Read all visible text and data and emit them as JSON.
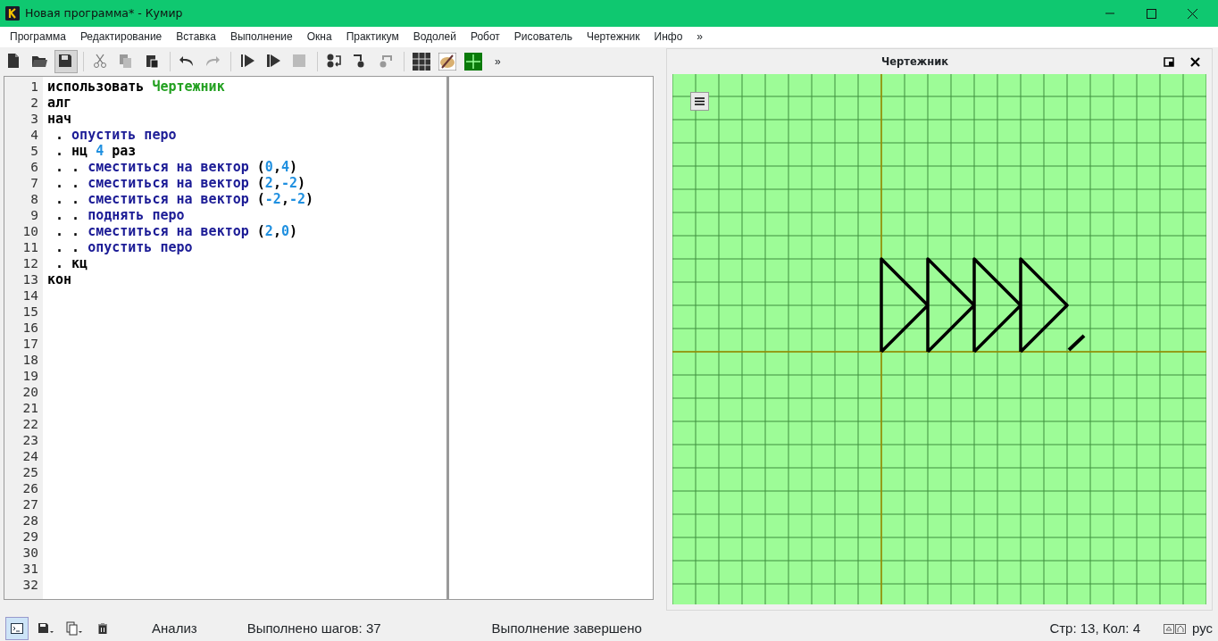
{
  "window": {
    "title": "Новая программа* - Кумир"
  },
  "menu": [
    {
      "label": "Программа"
    },
    {
      "label": "Редактирование"
    },
    {
      "label": "Вставка"
    },
    {
      "label": "Выполнение"
    },
    {
      "label": "Окна"
    },
    {
      "label": "Практикум"
    },
    {
      "label": "Водолей"
    },
    {
      "label": "Робот"
    },
    {
      "label": "Рисователь"
    },
    {
      "label": "Чертежник"
    },
    {
      "label": "Инфо"
    },
    {
      "label": "»"
    }
  ],
  "toolbar": {
    "overflow": "»"
  },
  "editor": {
    "lines": [
      {
        "number": "1",
        "tokens": [
          {
            "text": "использовать ",
            "kind": "keyword"
          },
          {
            "text": "Чертежник",
            "kind": "module"
          }
        ]
      },
      {
        "number": "2",
        "tokens": [
          {
            "text": "алг",
            "kind": "keyword"
          }
        ]
      },
      {
        "number": "3",
        "tokens": [
          {
            "text": "нач",
            "kind": "keyword"
          }
        ]
      },
      {
        "number": "4",
        "tokens": [
          {
            "text": " . ",
            "kind": "plain"
          },
          {
            "text": "опустить перо",
            "kind": "command"
          }
        ]
      },
      {
        "number": "5",
        "tokens": [
          {
            "text": " . ",
            "kind": "plain"
          },
          {
            "text": "нц ",
            "kind": "keyword"
          },
          {
            "text": "4",
            "kind": "number"
          },
          {
            "text": " раз",
            "kind": "keyword"
          }
        ]
      },
      {
        "number": "6",
        "tokens": [
          {
            "text": " . . ",
            "kind": "plain"
          },
          {
            "text": "сместиться на вектор",
            "kind": "command"
          },
          {
            "text": " (",
            "kind": "plain"
          },
          {
            "text": "0",
            "kind": "number"
          },
          {
            "text": ",",
            "kind": "plain"
          },
          {
            "text": "4",
            "kind": "number"
          },
          {
            "text": ")",
            "kind": "plain"
          }
        ]
      },
      {
        "number": "7",
        "tokens": [
          {
            "text": " . . ",
            "kind": "plain"
          },
          {
            "text": "сместиться на вектор",
            "kind": "command"
          },
          {
            "text": " (",
            "kind": "plain"
          },
          {
            "text": "2",
            "kind": "number"
          },
          {
            "text": ",",
            "kind": "plain"
          },
          {
            "text": "-2",
            "kind": "number"
          },
          {
            "text": ")",
            "kind": "plain"
          }
        ]
      },
      {
        "number": "8",
        "tokens": [
          {
            "text": " . . ",
            "kind": "plain"
          },
          {
            "text": "сместиться на вектор",
            "kind": "command"
          },
          {
            "text": " (",
            "kind": "plain"
          },
          {
            "text": "-2",
            "kind": "number"
          },
          {
            "text": ",",
            "kind": "plain"
          },
          {
            "text": "-2",
            "kind": "number"
          },
          {
            "text": ")",
            "kind": "plain"
          }
        ]
      },
      {
        "number": "9",
        "tokens": [
          {
            "text": " . . ",
            "kind": "plain"
          },
          {
            "text": "поднять перо",
            "kind": "command"
          }
        ]
      },
      {
        "number": "10",
        "tokens": [
          {
            "text": " . . ",
            "kind": "plain"
          },
          {
            "text": "сместиться на вектор",
            "kind": "command"
          },
          {
            "text": " (",
            "kind": "plain"
          },
          {
            "text": "2",
            "kind": "number"
          },
          {
            "text": ",",
            "kind": "plain"
          },
          {
            "text": "0",
            "kind": "number"
          },
          {
            "text": ")",
            "kind": "plain"
          }
        ]
      },
      {
        "number": "11",
        "tokens": [
          {
            "text": " . . ",
            "kind": "plain"
          },
          {
            "text": "опустить перо",
            "kind": "command"
          }
        ]
      },
      {
        "number": "12",
        "tokens": [
          {
            "text": " . ",
            "kind": "plain"
          },
          {
            "text": "кц",
            "kind": "keyword"
          }
        ]
      },
      {
        "number": "13",
        "tokens": [
          {
            "text": "кон",
            "kind": "keyword"
          }
        ]
      },
      {
        "number": "14"
      },
      {
        "number": "15"
      },
      {
        "number": "16"
      },
      {
        "number": "17"
      },
      {
        "number": "18"
      },
      {
        "number": "19"
      },
      {
        "number": "20"
      },
      {
        "number": "21"
      },
      {
        "number": "22"
      },
      {
        "number": "23"
      },
      {
        "number": "24"
      },
      {
        "number": "25"
      },
      {
        "number": "26"
      },
      {
        "number": "27"
      },
      {
        "number": "28"
      },
      {
        "number": "29"
      },
      {
        "number": "30"
      },
      {
        "number": "31"
      },
      {
        "number": "32"
      }
    ]
  },
  "drawer_panel": {
    "title": "Чертежник"
  },
  "status_bar": {
    "mode": "Анализ",
    "steps": "Выполнено шагов: 37",
    "state": "Выполнение завершено",
    "position": "Стр: 13, Кол: 4",
    "language": "рус"
  }
}
